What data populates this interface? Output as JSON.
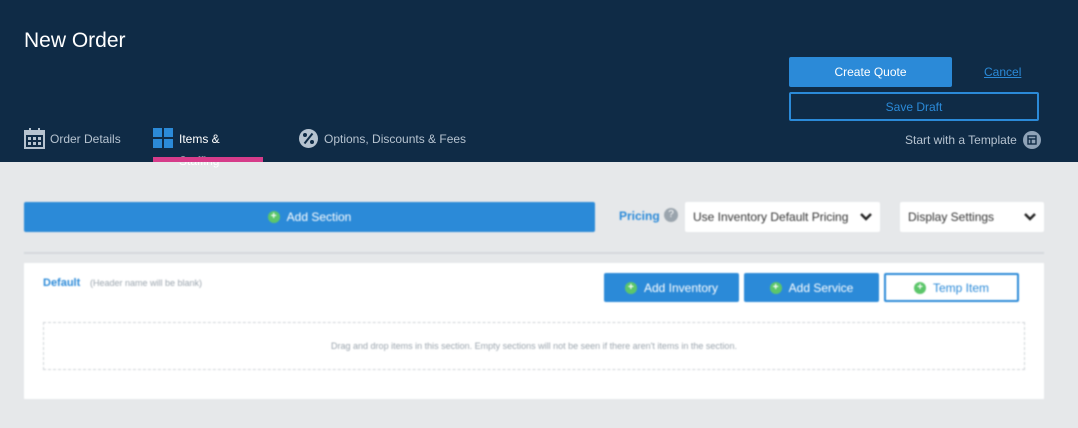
{
  "header": {
    "title": "New Order",
    "create_quote_label": "Create Quote",
    "cancel_label": "Cancel",
    "save_draft_label": "Save Draft"
  },
  "tabs": [
    {
      "label": "Order Details",
      "icon": "calendar-icon",
      "active": false
    },
    {
      "label": "Items & Staffing",
      "icon": "grid-icon",
      "active": true
    },
    {
      "label": "Options, Discounts & Fees",
      "icon": "percent-badge-icon",
      "active": false
    }
  ],
  "template": {
    "label": "Start with a Template",
    "icon": "template-icon"
  },
  "toolbar": {
    "add_section_label": "Add Section",
    "pricing_label": "Pricing",
    "pricing_value": "Use Inventory Default Pricing",
    "display_settings_label": "Display Settings"
  },
  "section": {
    "name": "Default",
    "hint": "(Header name will be blank)",
    "add_inventory_label": "Add Inventory",
    "add_service_label": "Add Service",
    "temp_item_label": "Temp Item",
    "drop_hint": "Drag and drop items in this section. Empty sections will not be seen if there aren't items in the section."
  },
  "colors": {
    "header_bg": "#0f2b46",
    "accent_blue": "#2b8ad8",
    "active_tab_underline": "#d63c8a",
    "add_icon_green": "#5cc66a"
  }
}
